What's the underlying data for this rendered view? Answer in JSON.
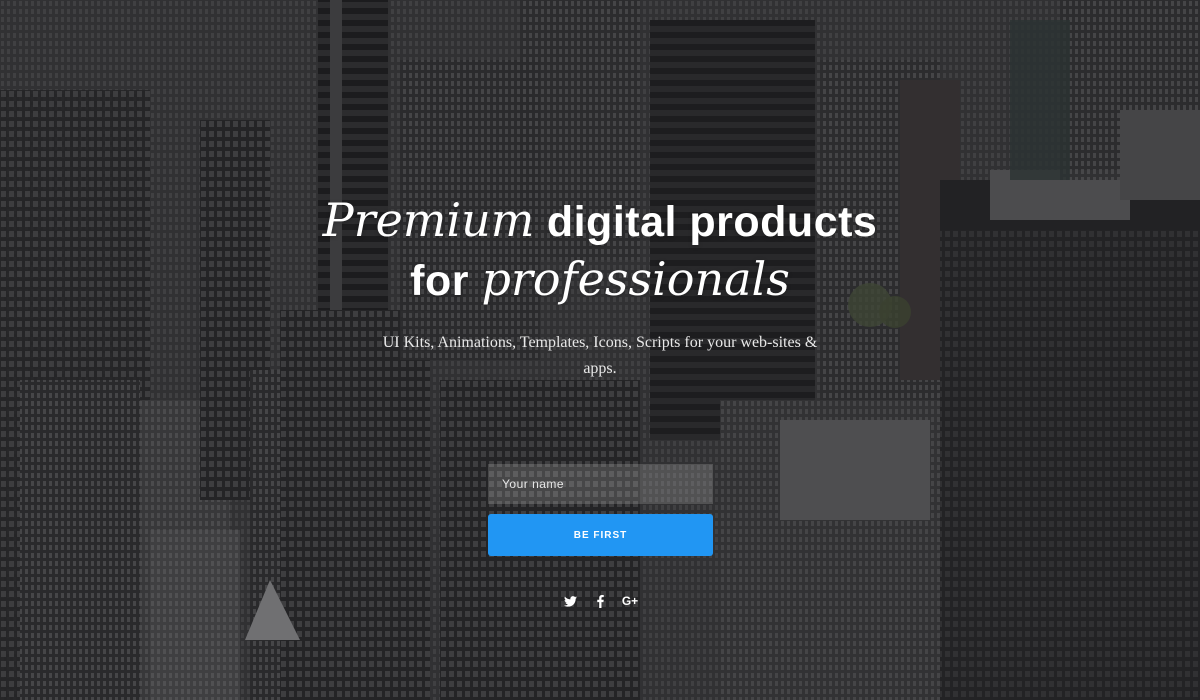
{
  "hero": {
    "headline": {
      "part1": "Premium",
      "part2": " digital products",
      "part3": "for ",
      "part4": "professionals"
    },
    "subtitle": "UI Kits, Animations, Templates, Icons, Scripts for your web-sites & apps."
  },
  "form": {
    "name_placeholder": "Your name",
    "name_value": "",
    "submit_label": "BE FIRST"
  },
  "social": [
    {
      "icon": "twitter-icon"
    },
    {
      "icon": "facebook-icon"
    },
    {
      "icon": "google-plus-icon",
      "label": "G+"
    }
  ],
  "colors": {
    "accent": "#2196f3",
    "overlay": "#19191c"
  }
}
